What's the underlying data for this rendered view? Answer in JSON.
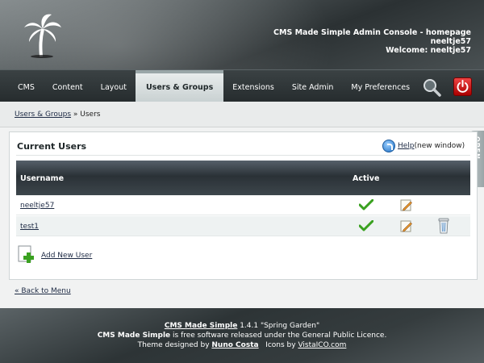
{
  "header": {
    "console_title": "CMS Made Simple Admin Console - homepage",
    "username": "neeltje57",
    "welcome": "Welcome: neeltje57"
  },
  "nav": {
    "items": [
      {
        "label": "CMS"
      },
      {
        "label": "Content"
      },
      {
        "label": "Layout"
      },
      {
        "label": "Users & Groups",
        "active": true
      },
      {
        "label": "Extensions"
      },
      {
        "label": "Site Admin"
      },
      {
        "label": "My Preferences"
      }
    ],
    "search_icon": "magnifier-icon",
    "logout_icon": "power-icon"
  },
  "breadcrumb": {
    "parent": "Users & Groups",
    "separator": " » ",
    "current": "Users"
  },
  "panel": {
    "title": "Current Users",
    "help_link": "Help",
    "help_suffix": " (new window)",
    "open_tab": "OPEN",
    "columns": {
      "username": "Username",
      "active": "Active"
    },
    "users": [
      {
        "name": "neeltje57",
        "active": true,
        "editable": true,
        "deletable": false
      },
      {
        "name": "test1",
        "active": true,
        "editable": true,
        "deletable": true
      }
    ],
    "add_user": "Add New User"
  },
  "back_link": "« Back to Menu",
  "footer": {
    "product": "CMS Made Simple",
    "version": " 1.4.1 \"Spring Garden\"",
    "license_name": "CMS Made Simple",
    "license_text": " is free software released under the General Public Licence.",
    "theme_prefix": "Theme designed by ",
    "theme_author": "Nuno Costa",
    "icons_prefix": "   Icons by ",
    "icons_author": "VistaICO.com"
  },
  "colors": {
    "active_tab_bg": "#dde3e4",
    "nav_bg": "#2f3638",
    "check_green": "#3aa120",
    "logout_red": "#d62222"
  }
}
